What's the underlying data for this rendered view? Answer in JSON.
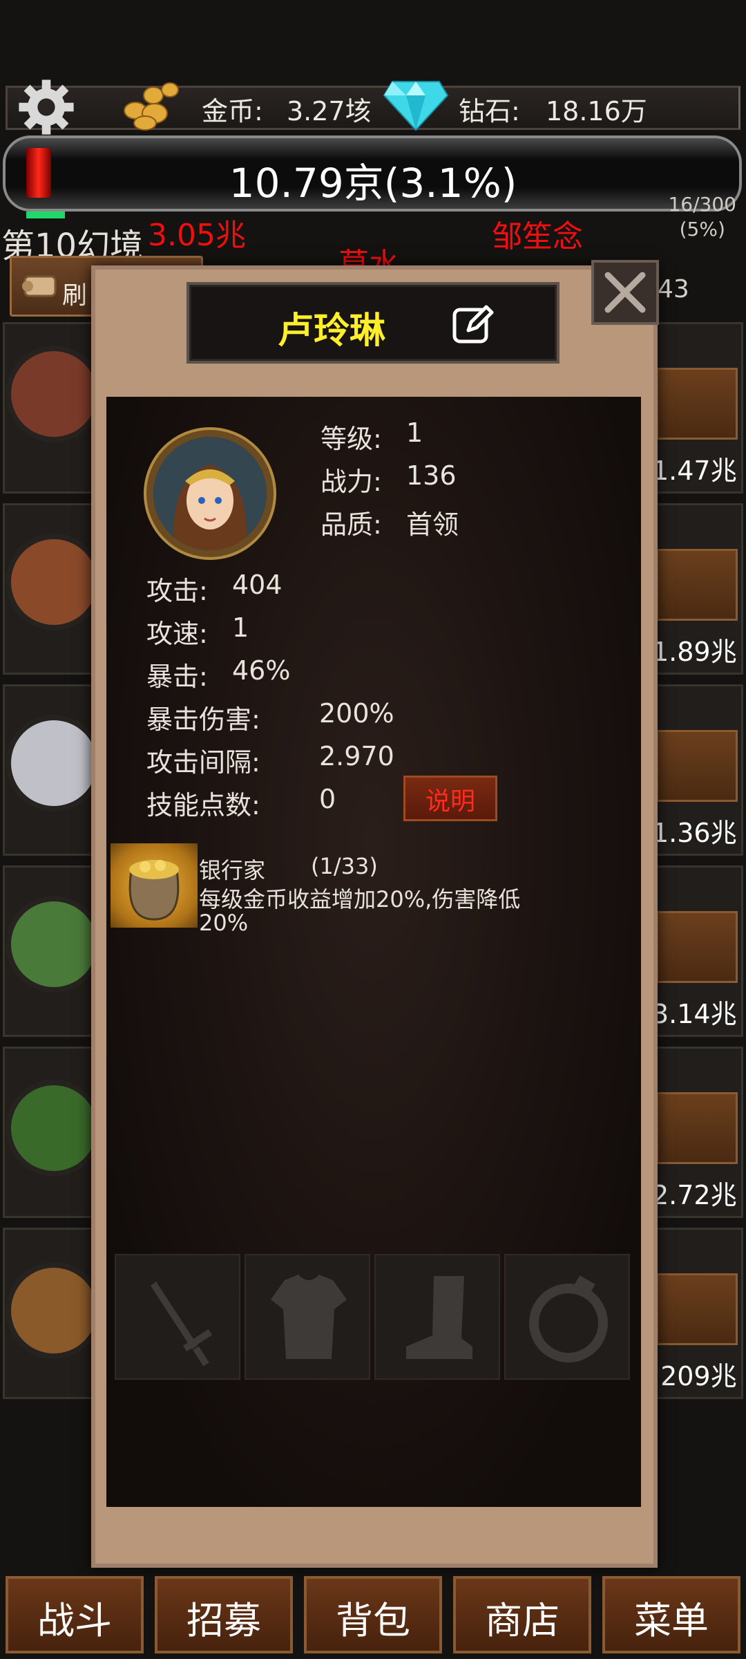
{
  "header": {
    "gold_label": "金币:",
    "gold_value": "3.27垓",
    "diamond_label": "钻石:",
    "diamond_value": "18.16万"
  },
  "boss": {
    "hp_text": "10.79京(3.1%)",
    "stage_count": "16/300",
    "stage_percent": "(5%)",
    "red_gauge_fraction": 0.031
  },
  "realm": "第10幻境",
  "behind": {
    "damage_1": "3.05兆",
    "name_1": "莫水",
    "name_2": "邹笙念",
    "refresh_label": "刷",
    "count_right": "43",
    "right_damages": [
      "1.47兆",
      "1.89兆",
      "1.36兆",
      "3.14兆",
      "2.72兆",
      ".209兆"
    ]
  },
  "hero": {
    "name": "卢玲琳",
    "level_label": "等级:",
    "level_value": "1",
    "power_label": "战力:",
    "power_value": "136",
    "quality_label": "品质:",
    "quality_value": "首领",
    "attack_label": "攻击:",
    "attack_value": "404",
    "speed_label": "攻速:",
    "speed_value": "1",
    "crit_label": "暴击:",
    "crit_value": "46%",
    "crit_dmg_label": "暴击伤害:",
    "crit_dmg_value": "200%",
    "interval_label": "攻击间隔:",
    "interval_value": "2.970",
    "skill_points_label": "技能点数:",
    "skill_points_value": "0",
    "explain_label": "说明"
  },
  "skill": {
    "name": "银行家",
    "progress": "(1/33)",
    "desc_line1": "每级金币收益增加20%,伤害降低",
    "desc_line2": "20%"
  },
  "equipment": [
    "sword",
    "armor",
    "boots",
    "ring"
  ],
  "nav": [
    "战斗",
    "招募",
    "背包",
    "商店",
    "菜单"
  ]
}
